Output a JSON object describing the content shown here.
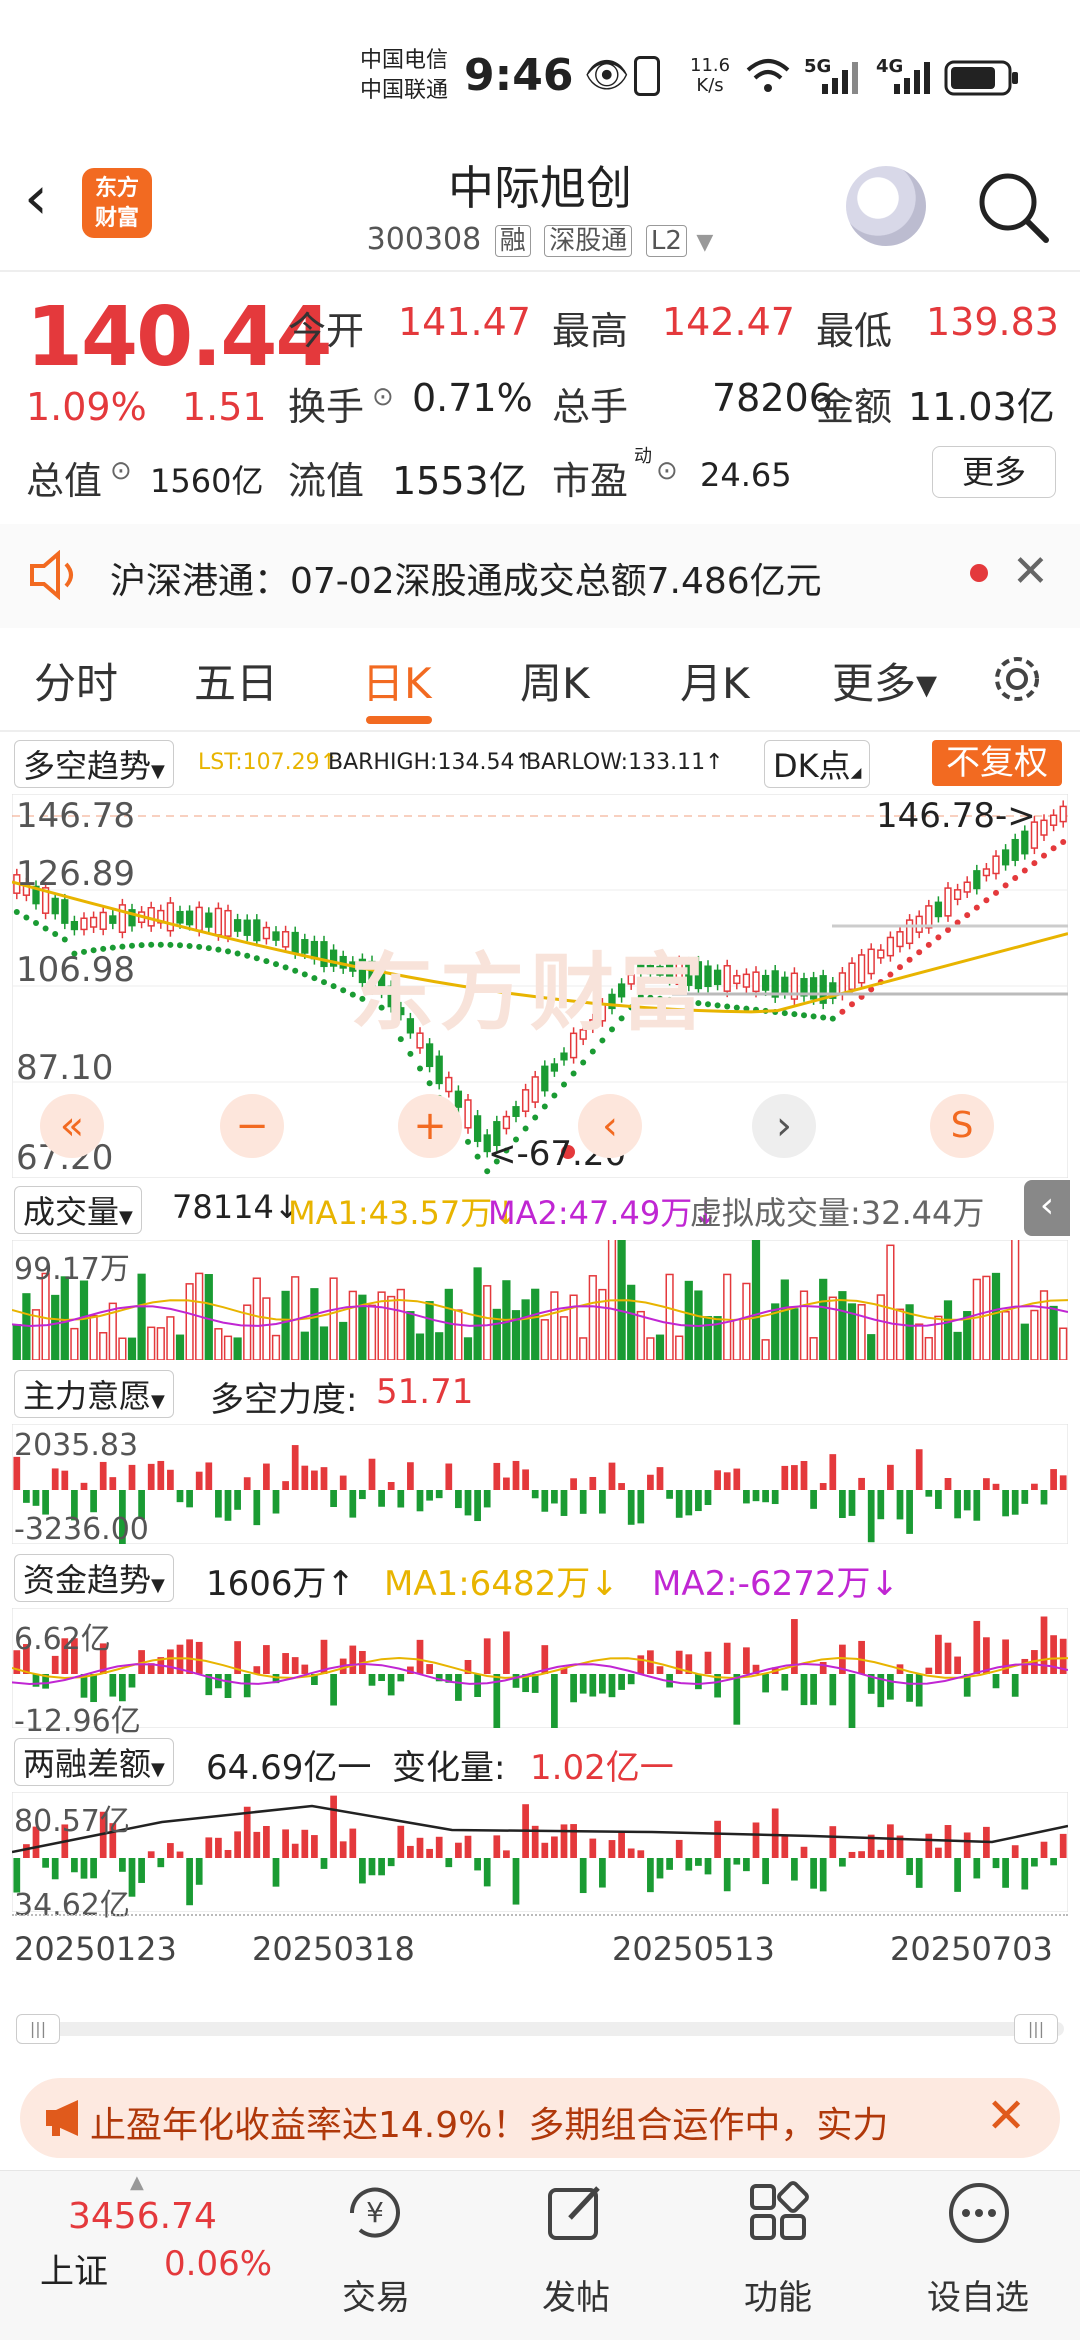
{
  "status_bar": {
    "carrier1": "中国电信",
    "carrier2": "中国联通",
    "time": "9:46",
    "net_speed": "11.6",
    "net_unit": "K/s",
    "signal1": "5G",
    "signal2": "4G"
  },
  "header": {
    "logo": "东方\n财富",
    "logo_line1": "东方",
    "logo_line2": "财富",
    "name": "中际旭创",
    "code": "300308",
    "tags": [
      "融",
      "深股通",
      "L2"
    ]
  },
  "quote": {
    "price": "140.44",
    "change_pct": "1.09%",
    "change_amt": "1.51",
    "open_label": "今开",
    "open": "141.47",
    "high_label": "最高",
    "high": "142.47",
    "low_label": "最低",
    "low": "139.83",
    "turnover_label": "换手",
    "turnover": "0.71%",
    "volume_label": "总手",
    "volume": "78206",
    "amount_label": "金额",
    "amount": "11.03亿",
    "mktcap_label": "总值",
    "mktcap": "1560亿",
    "float_label": "流值",
    "float": "1553亿",
    "pe_label": "市盈",
    "pe_sup": "动",
    "pe": "24.65",
    "more": "更多"
  },
  "notice": {
    "text": "沪深港通：07-02深股通成交总额7.486亿元"
  },
  "tabs": [
    "分时",
    "五日",
    "日K",
    "周K",
    "月K",
    "更多▾"
  ],
  "active_tab": "日K",
  "kline": {
    "indicator": "多空趋势",
    "lst": "LST:107.29↑",
    "barhigh": "BARHIGH:134.54↑",
    "barlow": "BARLOW:133.11↑",
    "dk": "DK点",
    "fq": "不复权",
    "y_labels": [
      "146.78",
      "126.89",
      "106.98",
      "87.10",
      "67.20"
    ],
    "max_marker": "146.78->",
    "min_marker": "<-67.20",
    "watermark": "东方财富"
  },
  "volume": {
    "label": "成交量",
    "value": "78114↓",
    "ma1": "MA1:43.57万↓",
    "ma2": "MA2:47.49万↓",
    "virtual": "虚拟成交量:32.44万",
    "top": "99.17万"
  },
  "main_force": {
    "label": "主力意愿",
    "text": "多空力度:",
    "value": "51.71",
    "top": "2035.83",
    "bottom": "-3236.00"
  },
  "fund_trend": {
    "label": "资金趋势",
    "value": "1606万↑",
    "ma1": "MA1:6482万↓",
    "ma2": "MA2:-6272万↓",
    "top": "6.62亿",
    "bottom": "-12.96亿"
  },
  "margin": {
    "label": "两融差额",
    "value": "64.69亿一",
    "change_label": "变化量:",
    "change": "1.02亿一",
    "top": "80.57亿",
    "bottom": "34.62亿"
  },
  "dates": [
    "20250123",
    "20250318",
    "20250513",
    "20250703"
  ],
  "ad": {
    "text": "止盈年化收益率达14.9%！多期组合运作中，实力"
  },
  "index": {
    "value": "3456.74",
    "name": "上证",
    "pct": "0.06%"
  },
  "nav": [
    "交易",
    "发帖",
    "功能",
    "设自选"
  ],
  "colors": {
    "up": "#e4393c",
    "down": "#1a9b33",
    "accent": "#f26a21",
    "ma1": "#e8b400",
    "ma2": "#c026d3"
  }
}
